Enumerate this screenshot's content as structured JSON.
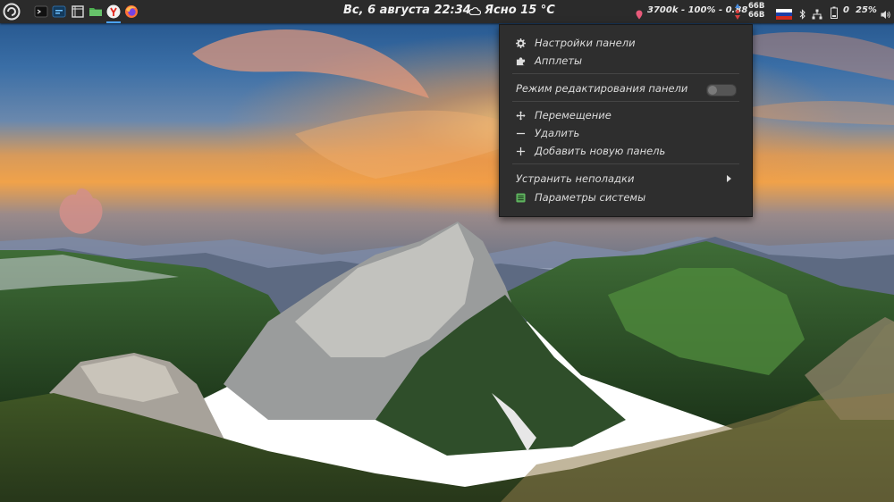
{
  "panel": {
    "clock": "Вс, 6 августа 22:34",
    "weather": "Ясно 15 °C",
    "icons": [
      "menu-logo-icon",
      "terminal-icon",
      "monitor-icon",
      "screenshot-icon",
      "files-icon",
      "yandex-browser-icon",
      "firefox-icon"
    ],
    "cpu_status": "3700k - 100% - 0.88",
    "net_up": "66B",
    "net_down": "66B",
    "battery_count": "0",
    "volume": "25%"
  },
  "menu": {
    "panel_settings": "Настройки панели",
    "applets": "Апплеты",
    "edit_mode": "Режим редактирования панели",
    "move": "Перемещение",
    "remove": "Удалить",
    "add_panel": "Добавить новую панель",
    "troubleshoot": "Устранить неполадки",
    "system_settings": "Параметры системы"
  },
  "colors": {
    "panel_bg": "#2b2b2b",
    "menu_bg": "#2e2e2e",
    "accent": "#4aa3ff"
  }
}
